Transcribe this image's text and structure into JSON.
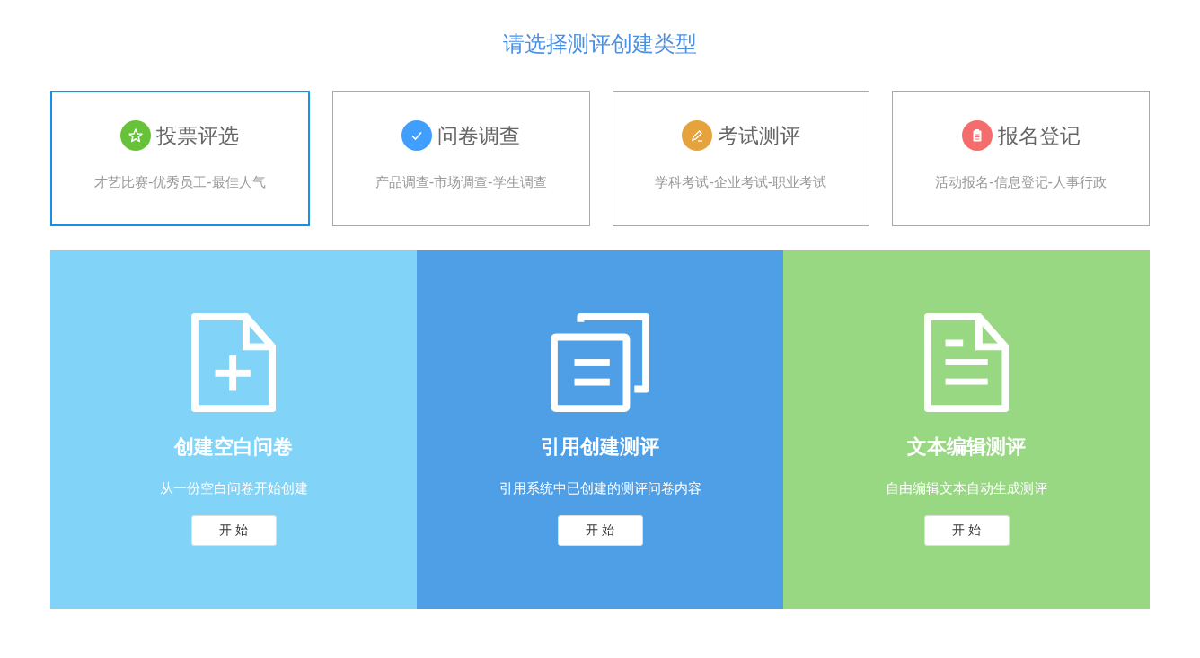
{
  "heading": "请选择测评创建类型",
  "types": [
    {
      "kind": "star",
      "color": "#67c23a",
      "title": "投票评选",
      "subtitle": "才艺比赛-优秀员工-最佳人气",
      "selected": true
    },
    {
      "kind": "check",
      "color": "#409eff",
      "title": "问卷调查",
      "subtitle": "产品调查-市场调查-学生调查",
      "selected": false
    },
    {
      "kind": "pencil",
      "color": "#e6a23c",
      "title": "考试测评",
      "subtitle": "学科考试-企业考试-职业考试",
      "selected": false
    },
    {
      "kind": "clipboard",
      "color": "#f56c6c",
      "title": "报名登记",
      "subtitle": "活动报名-信息登记-人事行政",
      "selected": false
    }
  ],
  "modes": [
    {
      "kind": "blank",
      "color": "#81d3f8",
      "title": "创建空白问卷",
      "description": "从一份空白问卷开始创建",
      "button": "开 始"
    },
    {
      "kind": "copy",
      "color": "#4e9fe6",
      "title": "引用创建测评",
      "description": "引用系统中已创建的测评问卷内容",
      "button": "开 始"
    },
    {
      "kind": "text",
      "color": "#98d883",
      "title": "文本编辑测评",
      "description": "自由编辑文本自动生成测评",
      "button": "开 始"
    }
  ]
}
